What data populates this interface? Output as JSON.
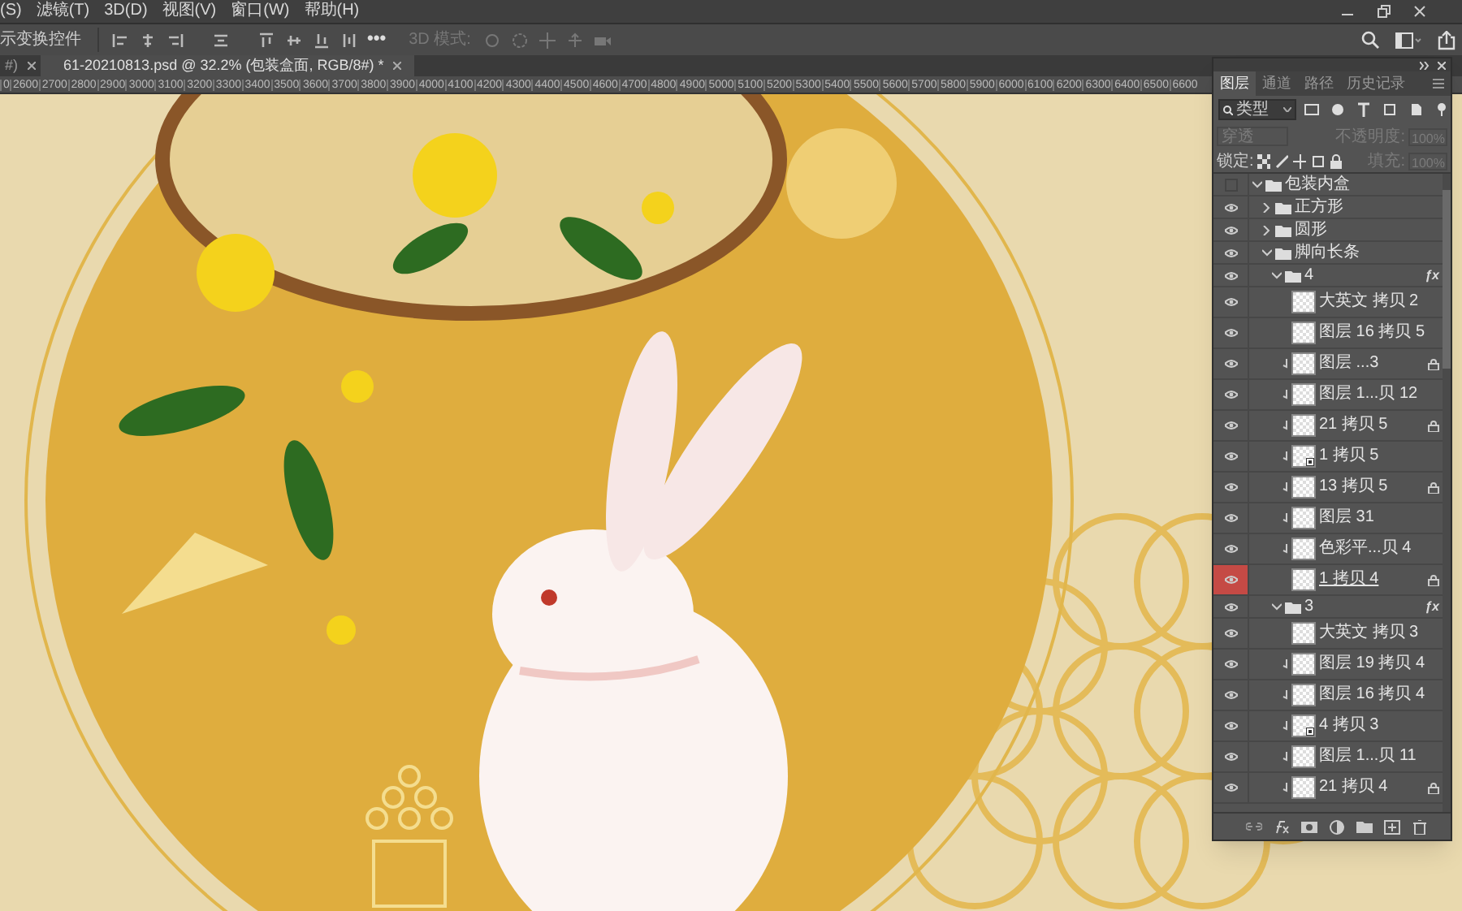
{
  "menu": [
    "(S)",
    "滤镜(T)",
    "3D(D)",
    "视图(V)",
    "窗口(W)",
    "帮助(H)"
  ],
  "options_bar": {
    "label": "示变换控件",
    "more": "•••",
    "mode_label": "3D 模式:"
  },
  "tabs": [
    {
      "title": "#)",
      "selected": false
    },
    {
      "title": "61-20210813.psd @ 32.2% (包装盒面, RGB/8#) *",
      "selected": true
    }
  ],
  "ruler": [
    "0",
    "2600",
    "2700",
    "2800",
    "2900",
    "3000",
    "3100",
    "3200",
    "3300",
    "3400",
    "3500",
    "3600",
    "3700",
    "3800",
    "3900",
    "4000",
    "4100",
    "4200",
    "4300",
    "4400",
    "4500",
    "4600",
    "4700",
    "4800",
    "4900",
    "5000",
    "5100",
    "5200",
    "5300",
    "5400",
    "5500",
    "5600",
    "5700",
    "5800",
    "5900",
    "6000",
    "6100",
    "6200",
    "6300",
    "6400",
    "6500",
    "6600"
  ],
  "panel": {
    "tabs": [
      {
        "label": "图层",
        "selected": true
      },
      {
        "label": "通道",
        "selected": false
      },
      {
        "label": "路径",
        "selected": false
      },
      {
        "label": "历史记录",
        "selected": false
      }
    ],
    "filter": "类型",
    "blend_mode": "穿透",
    "opacity_label": "不透明度:",
    "opacity": "100%",
    "lock_label": "锁定:",
    "fill_label": "填充:",
    "fill": "100%"
  },
  "layers": [
    {
      "kind": "group",
      "name": "包装内盒",
      "visible": false,
      "selected": false,
      "expanded": true,
      "children": [
        {
          "kind": "group",
          "name": "正方形",
          "visible": true,
          "selected": false,
          "expanded": false
        },
        {
          "kind": "group",
          "name": "圆形",
          "visible": true,
          "selected": false,
          "expanded": false
        },
        {
          "kind": "group",
          "name": "脚向长条",
          "visible": true,
          "selected": false,
          "expanded": true,
          "children": [
            {
              "kind": "group",
              "name": "4",
              "visible": true,
              "selected": false,
              "expanded": true,
              "effects": "ƒx",
              "children": [
                {
                  "kind": "layer",
                  "name": "大英文 拷贝 2",
                  "visible": true,
                  "selected": false,
                  "clipped": false,
                  "locked": false,
                  "smart": false
                },
                {
                  "kind": "layer",
                  "name": "图层 16 拷贝 5",
                  "visible": true,
                  "selected": false,
                  "clipped": false,
                  "locked": false,
                  "smart": false
                },
                {
                  "kind": "layer",
                  "name": "图层 ...3",
                  "visible": true,
                  "selected": false,
                  "clipped": true,
                  "locked": true,
                  "smart": false
                },
                {
                  "kind": "layer",
                  "name": "图层 1...贝 12",
                  "visible": true,
                  "selected": false,
                  "clipped": true,
                  "locked": false,
                  "smart": false
                },
                {
                  "kind": "layer",
                  "name": "21 拷贝 5",
                  "visible": true,
                  "selected": false,
                  "clipped": true,
                  "locked": true,
                  "smart": false
                },
                {
                  "kind": "layer",
                  "name": "1 拷贝 5",
                  "visible": true,
                  "selected": false,
                  "clipped": true,
                  "locked": false,
                  "smart": true
                },
                {
                  "kind": "layer",
                  "name": "13 拷贝 5",
                  "visible": true,
                  "selected": false,
                  "clipped": true,
                  "locked": true,
                  "smart": false
                },
                {
                  "kind": "layer",
                  "name": "图层 31",
                  "visible": true,
                  "selected": false,
                  "clipped": true,
                  "locked": false,
                  "smart": false
                },
                {
                  "kind": "layer",
                  "name": "色彩平...贝 4",
                  "visible": true,
                  "selected": false,
                  "clipped": true,
                  "locked": false,
                  "smart": false
                },
                {
                  "kind": "layer",
                  "name": "1 拷贝 4",
                  "visible": true,
                  "selected": true,
                  "clipped": false,
                  "locked": true,
                  "smart": false
                }
              ]
            },
            {
              "kind": "group",
              "name": "3",
              "visible": true,
              "selected": false,
              "expanded": true,
              "effects": "ƒx",
              "children": [
                {
                  "kind": "layer",
                  "name": "大英文 拷贝 3",
                  "visible": true,
                  "selected": false,
                  "clipped": false,
                  "locked": false,
                  "smart": false
                },
                {
                  "kind": "layer",
                  "name": "图层 19 拷贝 4",
                  "visible": true,
                  "selected": false,
                  "clipped": true,
                  "locked": false,
                  "smart": false
                },
                {
                  "kind": "layer",
                  "name": "图层 16 拷贝 4",
                  "visible": true,
                  "selected": false,
                  "clipped": true,
                  "locked": false,
                  "smart": false
                },
                {
                  "kind": "layer",
                  "name": "4 拷贝 3",
                  "visible": true,
                  "selected": false,
                  "clipped": true,
                  "locked": false,
                  "smart": true
                },
                {
                  "kind": "layer",
                  "name": "图层 1...贝 11",
                  "visible": true,
                  "selected": false,
                  "clipped": true,
                  "locked": false,
                  "smart": false
                },
                {
                  "kind": "layer",
                  "name": "21 拷贝 4",
                  "visible": true,
                  "selected": false,
                  "clipped": true,
                  "locked": true,
                  "smart": false
                }
              ]
            }
          ]
        }
      ]
    }
  ]
}
